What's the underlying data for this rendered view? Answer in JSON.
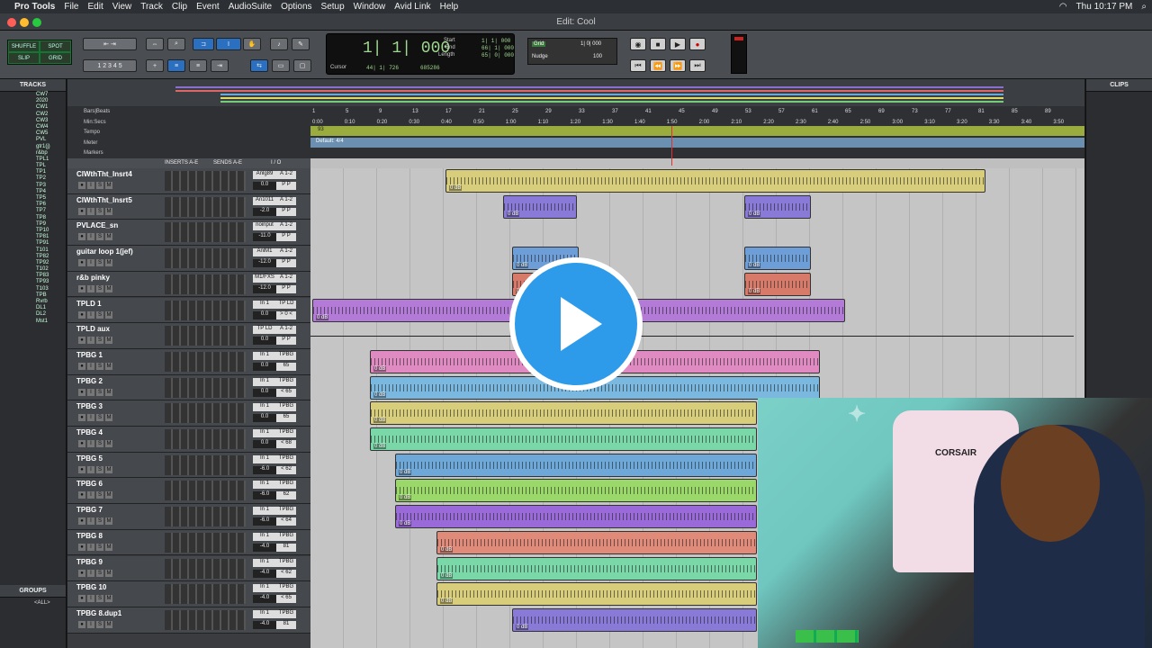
{
  "menubar": {
    "app": "Pro Tools",
    "items": [
      "File",
      "Edit",
      "View",
      "Track",
      "Clip",
      "Event",
      "AudioSuite",
      "Options",
      "Setup",
      "Window",
      "Avid Link",
      "Help"
    ],
    "clock": "Thu 10:17 PM"
  },
  "window": {
    "title": "Edit: Cool"
  },
  "toolbar": {
    "modes": [
      "SHUFFLE",
      "SPOT",
      "SLIP",
      "GRID"
    ],
    "counter_main": "1| 1| 000",
    "start_label": "Start",
    "start_val": "1| 1| 000",
    "end_label": "End",
    "end_val": "66| 1| 000",
    "length_label": "Length",
    "length_val": "65| 0| 000",
    "cursor_label": "Cursor",
    "cursor_val": "44| 1| 726",
    "sample_val": "685286",
    "grid_label": "Grid",
    "grid_val": "1| 0| 000",
    "nudge_label": "Nudge",
    "nudge_val": "100"
  },
  "tracks_panel": {
    "title": "TRACKS",
    "items": [
      "CW7",
      "2020",
      "CW1",
      "CW2",
      "CW3",
      "CW4",
      "CW5",
      "PVL",
      "gtr1(j)",
      "r&bp",
      "TPL1",
      "TPL",
      "TP1",
      "TP2",
      "TP3",
      "TP4",
      "TP5",
      "TP6",
      "TP7",
      "TP8",
      "TP9",
      "TP10",
      "TP81",
      "TP91",
      "T101",
      "TP82",
      "TP92",
      "T102",
      "TP83",
      "TP93",
      "T103",
      "TPB",
      "Rvrb",
      "DL1",
      "DL2",
      "Mst1"
    ]
  },
  "groups_panel": {
    "title": "GROUPS",
    "all": "<ALL>"
  },
  "clips_panel": {
    "title": "CLIPS"
  },
  "rulers": {
    "bars_label": "Bars|Beats",
    "min_label": "Min:Secs",
    "tempo_label": "Tempo",
    "meter_label": "Meter",
    "markers_label": "Markers",
    "tempo_val": "93",
    "meter_val": "Default: 4/4",
    "bars": [
      "1",
      "5",
      "9",
      "13",
      "17",
      "21",
      "25",
      "29",
      "33",
      "37",
      "41",
      "45",
      "49",
      "53",
      "57",
      "61",
      "65",
      "69",
      "73",
      "77",
      "81",
      "85",
      "89"
    ],
    "times": [
      "0:00",
      "0:10",
      "0:20",
      "0:30",
      "0:40",
      "0:50",
      "1:00",
      "1:10",
      "1:20",
      "1:30",
      "1:40",
      "1:50",
      "2:00",
      "2:10",
      "2:20",
      "2:30",
      "2:40",
      "2:50",
      "3:00",
      "3:10",
      "3:20",
      "3:30",
      "3:40",
      "3:50"
    ]
  },
  "column_headers": {
    "inserts": "INSERTS A-E",
    "sends": "SENDS A-E",
    "io": "I / O"
  },
  "tracks": [
    {
      "name": "ClWthTht_Insrt4",
      "io": "Anlg89",
      "out": "A 1-2",
      "vol": "0.0",
      "pan": "P  P"
    },
    {
      "name": "ClWthTht_Insrt5",
      "io": "An1011",
      "out": "A 1-2",
      "vol": "-2.0",
      "pan": "P  P"
    },
    {
      "name": "PVLACE_sn",
      "io": "noinput",
      "out": "A 1-2",
      "vol": "-11.0",
      "pan": "P  P"
    },
    {
      "name": "guitar loop 1(jef)",
      "io": "AnlM1",
      "out": "A 1-2",
      "vol": "-12.0",
      "pan": "P  P"
    },
    {
      "name": "r&b pinky",
      "io": "M1/FXS",
      "out": "A 1-2",
      "vol": "-12.0",
      "pan": "P  P"
    },
    {
      "name": "TPLD 1",
      "io": "In 1",
      "out": "TP LD",
      "vol": "0.0",
      "pan": "> 0 <"
    },
    {
      "name": "TPLD aux",
      "io": "TP LD",
      "out": "A 1-2",
      "vol": "0.0",
      "pan": "P  P"
    },
    {
      "name": "TPBG 1",
      "io": "In 1",
      "out": "TPBG",
      "vol": "0.0",
      "pan": "65"
    },
    {
      "name": "TPBG 2",
      "io": "In 1",
      "out": "TPBG",
      "vol": "0.0",
      "pan": "< 65"
    },
    {
      "name": "TPBG 3",
      "io": "In 1",
      "out": "TPBG",
      "vol": "0.0",
      "pan": "65"
    },
    {
      "name": "TPBG 4",
      "io": "In 1",
      "out": "TPBG",
      "vol": "0.0",
      "pan": "< 68"
    },
    {
      "name": "TPBG 5",
      "io": "In 1",
      "out": "TPBG",
      "vol": "-6.0",
      "pan": "< 62"
    },
    {
      "name": "TPBG 6",
      "io": "In 1",
      "out": "TPBG",
      "vol": "-6.0",
      "pan": "62"
    },
    {
      "name": "TPBG 7",
      "io": "In 1",
      "out": "TPBG",
      "vol": "-6.0",
      "pan": "< 64"
    },
    {
      "name": "TPBG 8",
      "io": "In 1",
      "out": "TPBG",
      "vol": "-4.0",
      "pan": "81"
    },
    {
      "name": "TPBG 9",
      "io": "In 1",
      "out": "TPBG",
      "vol": "-4.0",
      "pan": "< 62"
    },
    {
      "name": "TPBG 10",
      "io": "In 1",
      "out": "TPBG",
      "vol": "-4.0",
      "pan": "< 65"
    },
    {
      "name": "TPBG 8.dup1",
      "io": "In 1",
      "out": "TPBG",
      "vol": "-4.0",
      "pan": "81"
    }
  ],
  "clip_gain": "0 dB",
  "colors": {
    "accent": "#2e9bea",
    "tempo": "#9aac3e",
    "meter": "#6a8fb0"
  },
  "webcam": {
    "brand": "CORSAIR"
  }
}
